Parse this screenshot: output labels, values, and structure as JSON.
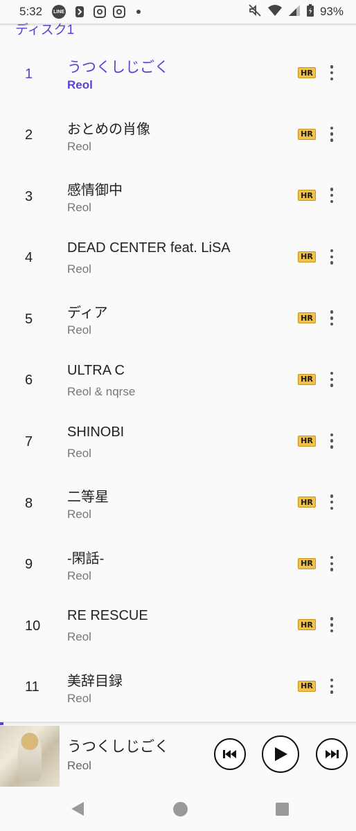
{
  "status_bar": {
    "time": "5:32",
    "battery": "93%",
    "icons": [
      "line-icon",
      "notification-app-icon",
      "instagram-icon",
      "instagram-icon",
      "dot-icon",
      "mute-icon",
      "wifi-icon",
      "signal-icon",
      "battery-icon"
    ]
  },
  "disc_header": "ディスク1",
  "tracks": [
    {
      "num": "1",
      "title": "うつくしじごく",
      "artist": "Reol",
      "badge": "HR"
    },
    {
      "num": "2",
      "title": "おとめの肖像",
      "artist": "Reol",
      "badge": "HR"
    },
    {
      "num": "3",
      "title": "感情御中",
      "artist": "Reol",
      "badge": "HR"
    },
    {
      "num": "4",
      "title": "DEAD CENTER feat. LiSA",
      "artist": "Reol",
      "badge": "HR"
    },
    {
      "num": "5",
      "title": "ディア",
      "artist": "Reol",
      "badge": "HR"
    },
    {
      "num": "6",
      "title": "ULTRA C",
      "artist": "Reol & nqrse",
      "badge": "HR"
    },
    {
      "num": "7",
      "title": "SHINOBI",
      "artist": "Reol",
      "badge": "HR"
    },
    {
      "num": "8",
      "title": "二等星",
      "artist": "Reol",
      "badge": "HR"
    },
    {
      "num": "9",
      "title": "-閑話-",
      "artist": "Reol",
      "badge": "HR"
    },
    {
      "num": "10",
      "title": "RE RESCUE",
      "artist": "Reol",
      "badge": "HR"
    },
    {
      "num": "11",
      "title": "美辞目録",
      "artist": "Reol",
      "badge": "HR"
    }
  ],
  "now_playing": {
    "title": "うつくしじごく",
    "artist": "Reol",
    "playing": false
  },
  "colors": {
    "accent": "#5b3fd6",
    "hr_badge": "#f2c14a",
    "background": "#fafafa"
  }
}
